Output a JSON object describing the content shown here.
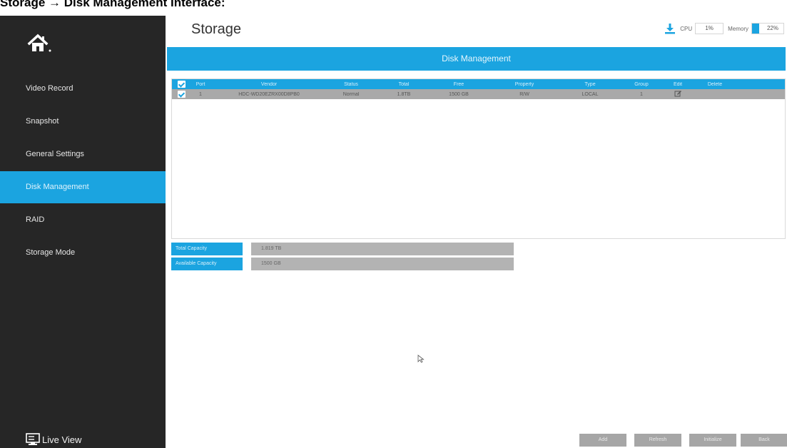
{
  "caption": "Storage → Disk Management Interface:",
  "sidebar": {
    "home_icon": "home-icon",
    "items": [
      {
        "label": "Video Record"
      },
      {
        "label": "Snapshot"
      },
      {
        "label": "General Settings"
      },
      {
        "label": "Disk Management",
        "active": true
      },
      {
        "label": "RAID"
      },
      {
        "label": "Storage Mode"
      }
    ],
    "live_view": {
      "label": "Live View",
      "icon": "monitor-icon"
    }
  },
  "header": {
    "title": "Storage",
    "download_icon": "download-icon",
    "cpu_label": "CPU",
    "cpu_value": "1%",
    "memory_label": "Memory",
    "memory_value": "22%",
    "memory_level": 0.22
  },
  "banner": {
    "title": "Disk Management"
  },
  "table": {
    "columns": [
      "Port",
      "Vendor",
      "Status",
      "Total",
      "Free",
      "Property",
      "Type",
      "Group",
      "Edit",
      "Delete"
    ],
    "rows": [
      {
        "port": "1",
        "vendor": "HDC-WD20EZRX00D8PB0",
        "status": "Normal",
        "total": "1.8TB",
        "free": "1500 GB",
        "property": "R/W",
        "type": "LOCAL",
        "group": "1",
        "edit_icon": "edit-icon",
        "delete": ""
      }
    ]
  },
  "capacity": {
    "total_label": "Total Capacity",
    "total_value": "1.819 TB",
    "available_label": "Available Capacity",
    "available_value": "1500 GB"
  },
  "buttons": {
    "add": "Add",
    "refresh": "Refresh",
    "initialize": "Initialize",
    "back": "Back"
  },
  "colors": {
    "accent": "#1ba4e0",
    "sidebar": "#262626",
    "button": "#a6a6a6"
  }
}
